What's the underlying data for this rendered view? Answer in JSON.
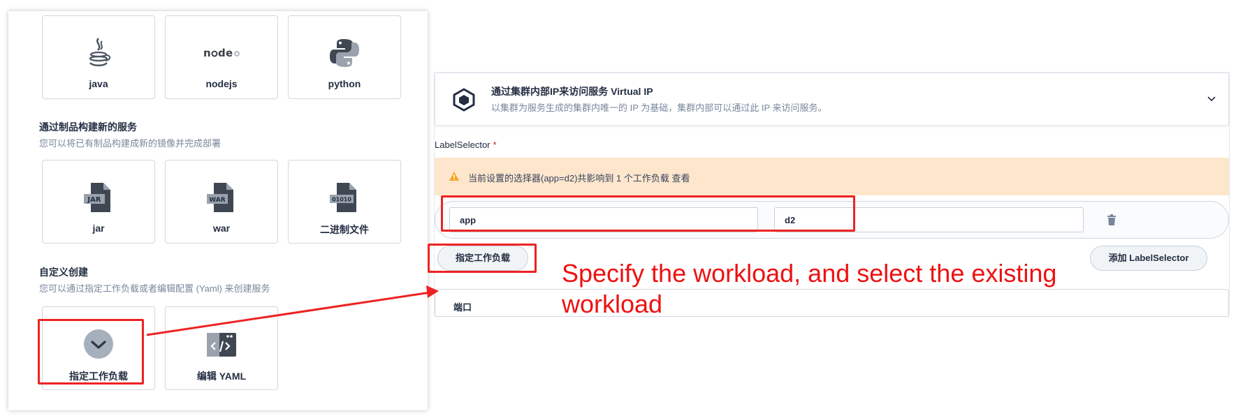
{
  "left": {
    "lang_cards": [
      {
        "label": "java",
        "icon": "java-icon"
      },
      {
        "label": "nodejs",
        "icon": "nodejs-icon"
      },
      {
        "label": "python",
        "icon": "python-icon"
      }
    ],
    "artifact_section": {
      "title": "通过制品构建新的服务",
      "desc": "您可以将已有制品构建成新的镜像并完成部署"
    },
    "artifact_cards": [
      {
        "label": "jar",
        "icon": "jar-file-icon",
        "badge": "JAR"
      },
      {
        "label": "war",
        "icon": "war-file-icon",
        "badge": "WAR"
      },
      {
        "label": "二进制文件",
        "icon": "binary-file-icon",
        "badge": "01010"
      }
    ],
    "custom_section": {
      "title": "自定义创建",
      "desc": "您可以通过指定工作负载或者编辑配置 (Yaml) 来创建服务"
    },
    "custom_cards": [
      {
        "label": "指定工作负载",
        "icon": "check-circle-icon"
      },
      {
        "label": "编辑 YAML",
        "icon": "code-window-icon"
      }
    ]
  },
  "right": {
    "vip_title": "通过集群内部IP来访问服务 Virtual IP",
    "vip_desc": "以集群为服务生成的集群内唯一的 IP 为基础，集群内部可以通过此 IP 来访问服务。",
    "label_selector_label": "LabelSelector",
    "required_mark": "*",
    "warning_text": "当前设置的选择器(app=d2)共影响到 1 个工作负载 查看",
    "selector_key": "app",
    "selector_value": "d2",
    "specify_workload_btn": "指定工作负载",
    "add_selector_btn": "添加 LabelSelector",
    "port_label": "端口"
  },
  "annotation": "Specify the workload, and select the existing workload",
  "colors": {
    "highlight": "#ee2222",
    "warning_bg": "#fde6cc",
    "warning_icon": "#f5a623"
  }
}
